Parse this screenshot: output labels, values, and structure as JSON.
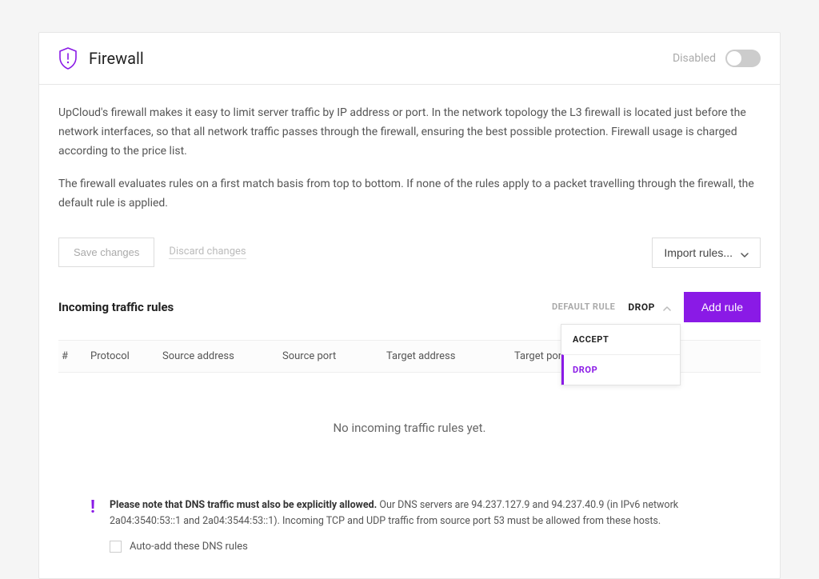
{
  "header": {
    "title": "Firewall",
    "status_label": "Disabled"
  },
  "description": {
    "p1": "UpCloud's firewall makes it easy to limit server traffic by IP address or port. In the network topology the L3 firewall is located just before the network interfaces, so that all network traffic passes through the firewall, ensuring the best possible protection. Firewall usage is charged according to the price list.",
    "p2": "The firewall evaluates rules on a first match basis from top to bottom. If none of the rules apply to a packet travelling through the firewall, the default rule is applied."
  },
  "actions": {
    "save_label": "Save changes",
    "discard_label": "Discard changes",
    "import_label": "Import rules..."
  },
  "incoming": {
    "title": "Incoming traffic rules",
    "default_rule_label": "DEFAULT RULE",
    "default_rule_value": "DROP",
    "add_label": "Add rule",
    "dropdown_options": [
      "ACCEPT",
      "DROP"
    ],
    "columns": {
      "idx": "#",
      "protocol": "Protocol",
      "source_address": "Source address",
      "source_port": "Source port",
      "target_address": "Target address",
      "target_port": "Target port"
    },
    "empty_text": "No incoming traffic rules yet."
  },
  "note": {
    "bold": "Please note that DNS traffic must also be explicitly allowed.",
    "rest": " Our DNS servers are 94.237.127.9 and 94.237.40.9 (in IPv6 network 2a04:3540:53::1 and 2a04:3544:53::1). Incoming TCP and UDP traffic from source port 53 must be allowed from these hosts.",
    "checkbox_label": "Auto-add these DNS rules"
  },
  "colors": {
    "accent": "#8a1ae6"
  }
}
